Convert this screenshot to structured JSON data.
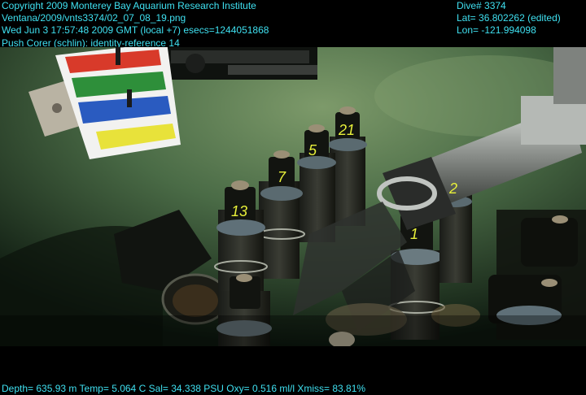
{
  "header": {
    "left": [
      "Copyright 2009 Monterey Bay Aquarium Research Institute",
      "Ventana/2009/vnts3374/02_07_08_19.png",
      "Wed Jun  3 17:57:48 2009 GMT (local +7)  esecs=1244051868",
      "Push Corer (schlin): identity-reference 14"
    ],
    "right": [
      "Dive# 3374",
      "Lat= 36.802262 (edited)",
      "Lon= -121.994098"
    ]
  },
  "footer": {
    "telemetry": "Depth= 635.93 m  Temp= 5.064 C  Sal= 34.338 PSU  Oxy= 0.516 ml/l  Xmiss= 83.81%"
  },
  "scene": {
    "core_labels": [
      "13",
      "7",
      "5",
      "21",
      "1",
      "2"
    ],
    "colors": {
      "overlay_text": "#3fe0f0",
      "seafloor": "#4a6b46",
      "core_label_text": "#e8f03a"
    }
  }
}
